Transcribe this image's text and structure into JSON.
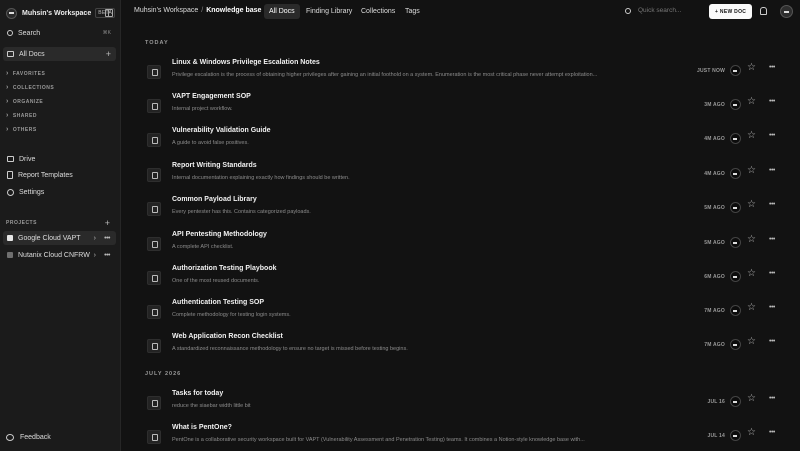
{
  "workspace": {
    "name": "Muhsin's Workspace",
    "badge": "BETA"
  },
  "sidebar": {
    "search_label": "Search",
    "search_shortcut": "⌘K",
    "all_docs_label": "All Docs",
    "sections": [
      "FAVORITES",
      "COLLECTIONS",
      "ORGANIZE",
      "SHARED",
      "OTHERS"
    ],
    "tools": [
      {
        "label": "Drive",
        "icon": "drive-icon"
      },
      {
        "label": "Report Templates",
        "icon": "template-icon"
      },
      {
        "label": "Settings",
        "icon": "gear-icon"
      }
    ],
    "projects_label": "PROJECTS",
    "projects": [
      {
        "label": "Google Cloud VAPT",
        "color": "#e6e6e6"
      },
      {
        "label": "Nutanix Cloud CNFRW",
        "color": "#6f6f6f"
      }
    ],
    "feedback_label": "Feedback"
  },
  "header": {
    "breadcrumb_workspace": "Muhsin's Workspace",
    "breadcrumb_separator": "/",
    "breadcrumb_current": "Knowledge base",
    "tabs": [
      "All Docs",
      "Finding Library",
      "Collections",
      "Tags"
    ],
    "active_tab": "All Docs",
    "search_placeholder": "Quick search...",
    "new_doc_label": "+ NEW DOC"
  },
  "groups": [
    {
      "label": "TODAY",
      "docs": [
        {
          "title": "Linux & Windows Privilege Escalation Notes",
          "desc": "Privilege escalation is the process of obtaining higher privileges after gaining an initial foothold on a system. Enumeration is the most critical phase never attempt exploitation...",
          "time": "JUST NOW"
        },
        {
          "title": "VAPT Engagement SOP",
          "desc": "Internal project workflow.",
          "time": "3M AGO"
        },
        {
          "title": "Vulnerability Validation Guide",
          "desc": "A guide to avoid false positives.",
          "time": "4M AGO"
        },
        {
          "title": "Report Writing Standards",
          "desc": "Internal documentation explaining exactly how findings should be written.",
          "time": "4M AGO"
        },
        {
          "title": "Common Payload Library",
          "desc": "Every pentester has this. Contains categorized payloads.",
          "time": "5M AGO"
        },
        {
          "title": "API Pentesting Methodology",
          "desc": "A complete API checklist.",
          "time": "5M AGO"
        },
        {
          "title": "Authorization Testing Playbook",
          "desc": "One of the most reused documents.",
          "time": "6M AGO"
        },
        {
          "title": "Authentication Testing SOP",
          "desc": "Complete methodology for testing login systems.",
          "time": "7M AGO"
        },
        {
          "title": "Web Application Recon Checklist",
          "desc": "A standardized reconnaissance methodology to ensure no target is missed before testing begins.",
          "time": "7M AGO"
        }
      ]
    },
    {
      "label": "JULY 2026",
      "docs": [
        {
          "title": "Tasks for today",
          "desc": "reduce the siaebar width little bit",
          "time": "JUL 16"
        },
        {
          "title": "What is PentOne?",
          "desc": "PentOne is a collaborative security workspace built for VAPT (Vulnerability Assessment and Penetration Testing) teams. It combines a Notion-style knowledge base with...",
          "time": "JUL 14"
        }
      ]
    }
  ]
}
